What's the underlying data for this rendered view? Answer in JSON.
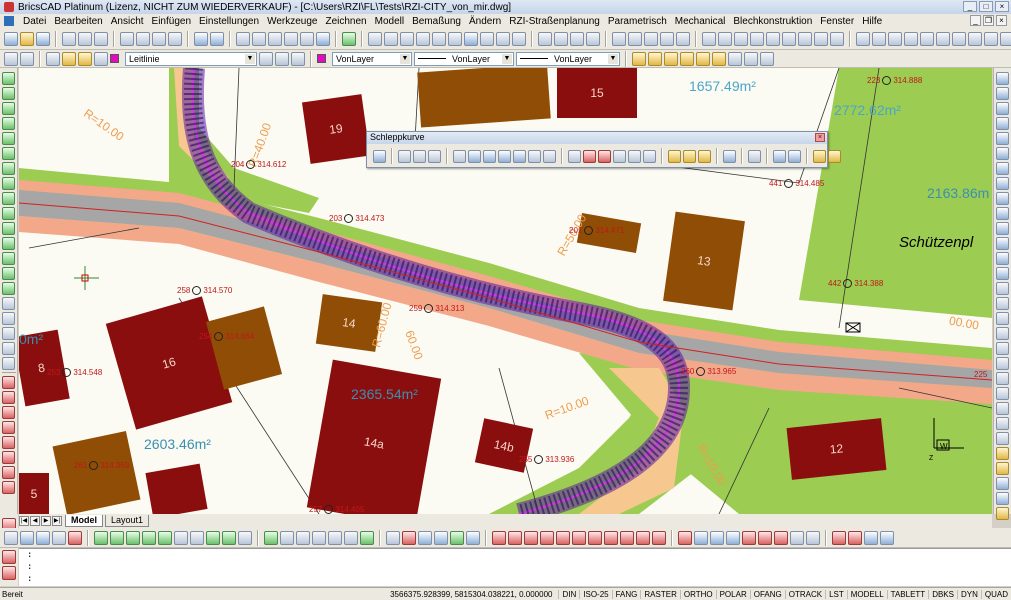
{
  "window": {
    "title": "BricsCAD Platinum (Lizenz, NICHT ZUM WIEDERVERKAUF) - [C:\\Users\\RZI\\FL\\Tests\\RZI-CITY_von_mir.dwg]"
  },
  "menu": [
    "Datei",
    "Bearbeiten",
    "Ansicht",
    "Einfügen",
    "Einstellungen",
    "Werkzeuge",
    "Zeichnen",
    "Modell",
    "Bemaßung",
    "Ändern",
    "RZI-Straßenplanung",
    "Parametrisch",
    "Mechanical",
    "Blechkonstruktion",
    "Fenster",
    "Hilfe"
  ],
  "properties_bar": {
    "layer": "Leitlinie",
    "color": "VonLayer",
    "linetype": "VonLayer",
    "lineweight": "VonLayer",
    "layer_color": "#e40ac2"
  },
  "floating_toolbar": {
    "title": "Schleppkurve"
  },
  "map": {
    "buildings": [
      "15",
      "19",
      "13",
      "16",
      "14",
      "14a",
      "14b",
      "12",
      "8",
      "5"
    ],
    "areas": [
      "1657.49m²",
      "2772.62m²",
      "2163.86m",
      "2365.54m²",
      "2603.46m²",
      "0m²"
    ],
    "street_name": "Schützenpl",
    "points": [
      {
        "id": "223",
        "elev": "314.888"
      },
      {
        "id": "204",
        "elev": "314.612"
      },
      {
        "id": "441",
        "elev": "314.485"
      },
      {
        "id": "203",
        "elev": "314.473"
      },
      {
        "id": "201",
        "elev": "314.471"
      },
      {
        "id": "442",
        "elev": "314.388"
      },
      {
        "id": "258",
        "elev": "314.570"
      },
      {
        "id": "259",
        "elev": "314.313"
      },
      {
        "id": "254",
        "elev": "314.664"
      },
      {
        "id": "253",
        "elev": "314.548"
      },
      {
        "id": "260",
        "elev": "313.965"
      },
      {
        "id": "255",
        "elev": "313.936"
      },
      {
        "id": "261",
        "elev": "314.359"
      },
      {
        "id": "257",
        "elev": "314.405"
      },
      {
        "id": "225",
        "elev": ""
      }
    ],
    "radii": [
      "R=10.00",
      "R=40.00",
      "R=50.00",
      "R=60.00",
      "60.00",
      "R=10.00",
      "R=10.00",
      "00.00"
    ]
  },
  "layout_tabs": [
    "Model",
    "Layout1"
  ],
  "command_lines": [
    ":",
    ":",
    ":"
  ],
  "status": {
    "state": "Bereit",
    "coords": "3566375.928399, 5815304.038221, 0.000000",
    "toggles": [
      "DIN",
      "ISO-25",
      "FANG",
      "RASTER",
      "ORTHO",
      "POLAR",
      "OFANG",
      "OTRACK",
      "LST",
      "MODELL",
      "TABLETT",
      "DBKS",
      "DYN",
      "QUAD"
    ]
  }
}
